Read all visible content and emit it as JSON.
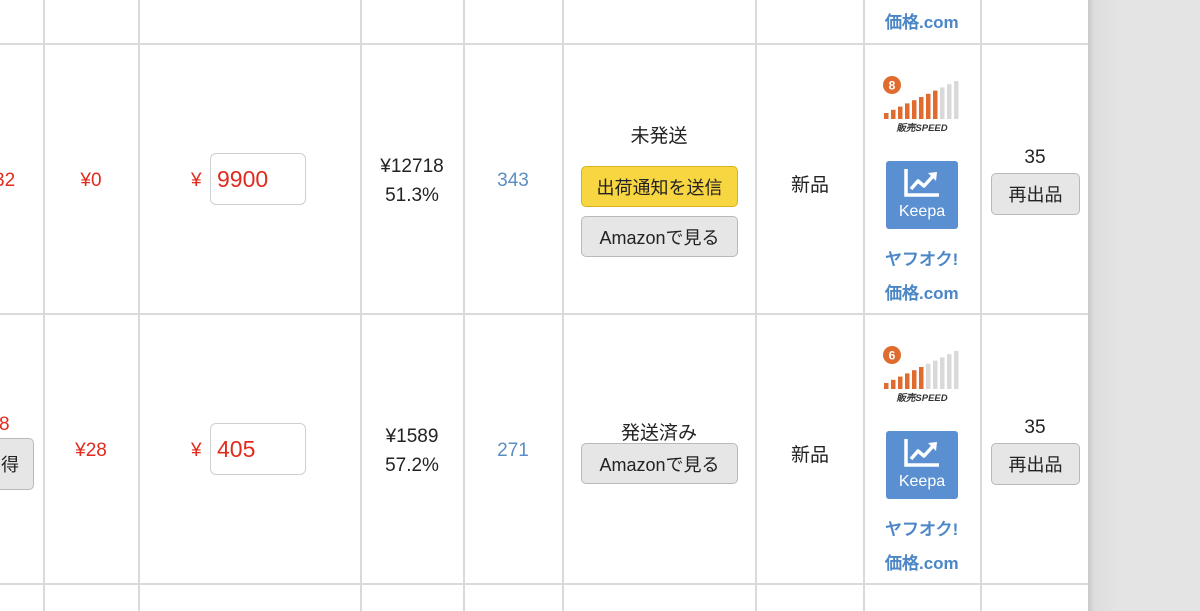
{
  "colors": {
    "accent_red": "#e12b1e",
    "link_blue": "#4b86c6",
    "notify_yellow": "#f7d641",
    "keepa_blue": "#5a8fd1",
    "speed_orange": "#e06b2e"
  },
  "top_row": {
    "kakaku_link": "価格.com"
  },
  "rows": [
    {
      "partial_left": "32",
      "shipping_cost": "¥0",
      "currency_symbol": "¥",
      "price_value": "9900",
      "amazon_price": "¥12718",
      "profit_rate": "51.3%",
      "rank_link": "343",
      "status": "未発送",
      "notify_button": "出荷通知を送信",
      "amazon_button": "Amazonで見る",
      "condition": "新品",
      "speed_badge_number": "8",
      "speed_label": "販売SPEED",
      "speed_level": 8,
      "keepa_label": "Keepa",
      "yahoo_link": "ヤフオク!",
      "kakaku_link": "価格.com",
      "stock_count": "35",
      "relist_button": "再出品"
    },
    {
      "partial_left": "8",
      "partial_left_button": "得",
      "shipping_cost": "¥28",
      "currency_symbol": "¥",
      "price_value": "405",
      "amazon_price": "¥1589",
      "profit_rate": "57.2%",
      "rank_link": "271",
      "status": "発送済み",
      "amazon_button": "Amazonで見る",
      "condition": "新品",
      "speed_badge_number": "6",
      "speed_label": "販売SPEED",
      "speed_level": 6,
      "keepa_label": "Keepa",
      "yahoo_link": "ヤフオク!",
      "kakaku_link": "価格.com",
      "stock_count": "35",
      "relist_button": "再出品"
    }
  ]
}
